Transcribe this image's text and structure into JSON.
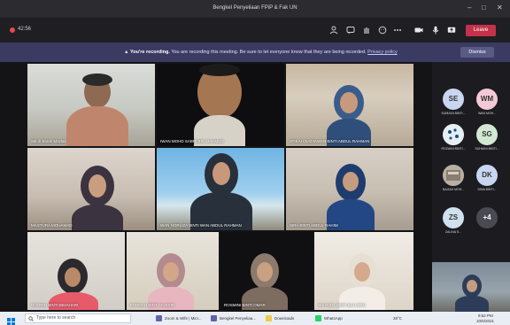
{
  "window": {
    "title": "Bengkel Penyeliaan FPiP & Fak UN",
    "controls": [
      "–",
      "□",
      "✕"
    ]
  },
  "toolbar": {
    "timer": "42:56",
    "leave_label": "Leave",
    "icons": [
      "people-icon",
      "chat-icon",
      "raise-hand-icon",
      "reactions-icon",
      "more-icon",
      "camera-icon",
      "mic-icon",
      "share-icon"
    ]
  },
  "banner": {
    "bold": "You're recording.",
    "text": " You are recording this meeting. Be sure to let everyone know that they are being recorded. ",
    "link": "Privacy policy",
    "dismiss_label": "Dismiss"
  },
  "tiles": [
    {
      "name": "Siti di Sarah Mazlan"
    },
    {
      "name": "IWAN MOHD SABRI BIN MAHMUD"
    },
    {
      "name": "ATIKAH NADIAWAN BINTI ABDUL RAHMAN"
    },
    {
      "name": "MASTURA MOHAMAD"
    },
    {
      "name": "WAN NORLIZA BINTI WAN ABDUL RAHMAN"
    },
    {
      "name": "SIRA BINTI ABDUL RAHIM"
    },
    {
      "name": "NOORIN BINTI BIDAHARI"
    },
    {
      "name": "FATIMAH BINTI HUSSIN"
    },
    {
      "name": "ROSMINI BINTI OMAR"
    },
    {
      "name": "SUHAIDA BINTI BAHARIN"
    }
  ],
  "sidebar": {
    "avatars": [
      {
        "initials": "SE",
        "label": "SUMAYA BINTI...",
        "color": "#c9d6f2"
      },
      {
        "initials": "WM",
        "label": "WAN MOH...",
        "color": "#f4c9d6"
      },
      {
        "initials": "",
        "label": "ROZAINI BINTI...",
        "color": "#cfe0ee"
      },
      {
        "initials": "SG",
        "label": "SUHAINI BINTI...",
        "color": "#d3e8d3"
      },
      {
        "initials": "",
        "label": "NAJIAH MOH...",
        "color": "#b9b0a3"
      },
      {
        "initials": "DK",
        "label": "DINA BINTI...",
        "color": "#c9d6f2"
      },
      {
        "initials": "ZS",
        "label": "ZALINA S...",
        "color": "#cfe0ee"
      },
      {
        "initials": "+4",
        "label": "",
        "color": "#4a4a52"
      }
    ]
  },
  "taskbar": {
    "search_placeholder": "Type here to search",
    "apps": [
      {
        "label": "Zoom & Wife | Micr...",
        "color": "#6264a7"
      },
      {
        "label": "Bengkel Penyeliaa...",
        "color": "#6264a7"
      },
      {
        "label": "Downloads",
        "color": "#f2c94c"
      },
      {
        "label": "WhatsApp",
        "color": "#25d366"
      }
    ],
    "weather": "28°C",
    "time": "9:52 PM",
    "date": "10/6/2021"
  }
}
